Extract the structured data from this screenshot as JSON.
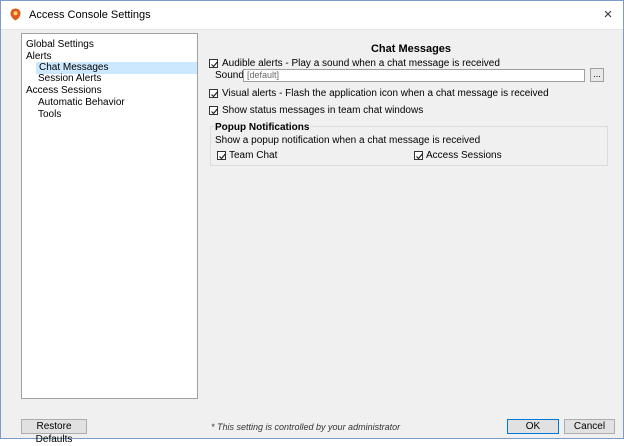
{
  "window": {
    "title": "Access Console Settings",
    "close_glyph": "×",
    "accent": "#e05a1a"
  },
  "tree": {
    "items": [
      {
        "label": "Global Settings",
        "level": 0
      },
      {
        "label": "Alerts",
        "level": 0
      },
      {
        "label": "Chat Messages",
        "level": 1,
        "selected": true
      },
      {
        "label": "Session Alerts",
        "level": 1
      },
      {
        "label": "Access Sessions",
        "level": 0
      },
      {
        "label": "Automatic Behavior",
        "level": 1
      },
      {
        "label": "Tools",
        "level": 1
      }
    ]
  },
  "panel": {
    "title": "Chat Messages",
    "audible_label": "Audible alerts - Play a sound when a chat message is received",
    "audible_checked": true,
    "sound_label": "Sound",
    "sound_value": "[default]",
    "browse_label": "...",
    "visual_label": "Visual alerts - Flash the application icon when a chat message is received",
    "visual_checked": true,
    "status_label": "Show status messages in team chat windows",
    "status_checked": true,
    "popup": {
      "title": "Popup Notifications",
      "description": "Show a popup notification when a chat message is received",
      "team_chat_label": "Team Chat",
      "team_chat_checked": true,
      "access_sessions_label": "Access Sessions",
      "access_sessions_checked": true
    }
  },
  "footer": {
    "restore_label": "Restore Defaults",
    "note": "* This setting is controlled by your administrator",
    "ok_label": "OK",
    "cancel_label": "Cancel"
  }
}
